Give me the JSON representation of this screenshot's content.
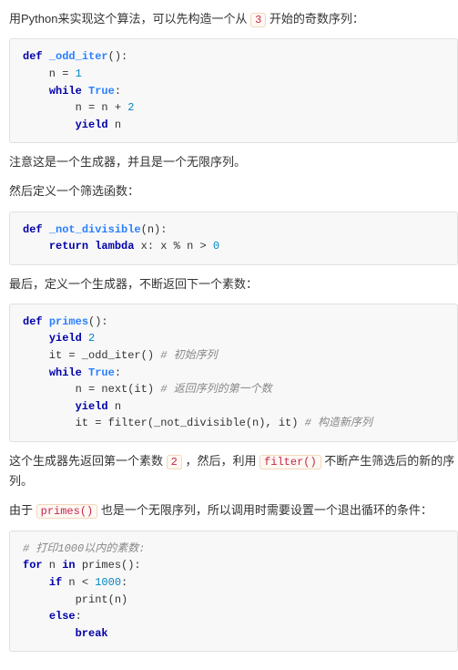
{
  "para": {
    "p1a": "用Python来实现这个算法，可以先构造一个从 ",
    "p1_code": "3",
    "p1b": " 开始的奇数序列：",
    "p2": "注意这是一个生成器，并且是一个无限序列。",
    "p3": "然后定义一个筛选函数：",
    "p4": "最后，定义一个生成器，不断返回下一个素数：",
    "p5a": "这个生成器先返回第一个素数 ",
    "p5_code1": "2",
    "p5b": " ，然后，利用 ",
    "p5_code2": "filter()",
    "p5c": " 不断产生筛选后的新的序列。",
    "p6a": "由于 ",
    "p6_code": "primes()",
    "p6b": " 也是一个无限序列，所以调用时需要设置一个退出循环的条件："
  },
  "code1": {
    "l1_def": "def",
    "l1_name": "_odd_iter",
    "l1_rest": "():",
    "l2_a": "    n = ",
    "l2_b": "1",
    "l3_a": "    ",
    "l3_while": "while",
    "l3_sp": " ",
    "l3_true": "True",
    "l3_colon": ":",
    "l4_a": "        n = n + ",
    "l4_b": "2",
    "l5_a": "        ",
    "l5_yield": "yield",
    "l5_b": " n"
  },
  "code2": {
    "l1_def": "def",
    "l1_name": "_not_divisible",
    "l1_rest": "(n):",
    "l2_a": "    ",
    "l2_return": "return",
    "l2_sp": " ",
    "l2_lambda": "lambda",
    "l2_b": " x: x % n > ",
    "l2_c": "0"
  },
  "code3": {
    "l1_def": "def",
    "l1_name": "primes",
    "l1_rest": "():",
    "l2_a": "    ",
    "l2_yield": "yield",
    "l2_sp": " ",
    "l2_b": "2",
    "l3_a": "    it = _odd_iter() ",
    "l3_cm": "# 初始序列",
    "l4_a": "    ",
    "l4_while": "while",
    "l4_sp": " ",
    "l4_true": "True",
    "l4_colon": ":",
    "l5_a": "        n = next(it) ",
    "l5_cm": "# 返回序列的第一个数",
    "l6_a": "        ",
    "l6_yield": "yield",
    "l6_b": " n",
    "l7_a": "        it = filter(_not_divisible(n), it) ",
    "l7_cm": "# 构造新序列"
  },
  "code4": {
    "l1_cm": "# 打印1000以内的素数:",
    "l2_for": "for",
    "l2_a": " n ",
    "l2_in": "in",
    "l2_b": " primes():",
    "l3_a": "    ",
    "l3_if": "if",
    "l3_b": " n < ",
    "l3_c": "1000",
    "l3_colon": ":",
    "l4": "        print(n)",
    "l5_a": "    ",
    "l5_else": "else",
    "l5_colon": ":",
    "l6_a": "        ",
    "l6_break": "break"
  }
}
